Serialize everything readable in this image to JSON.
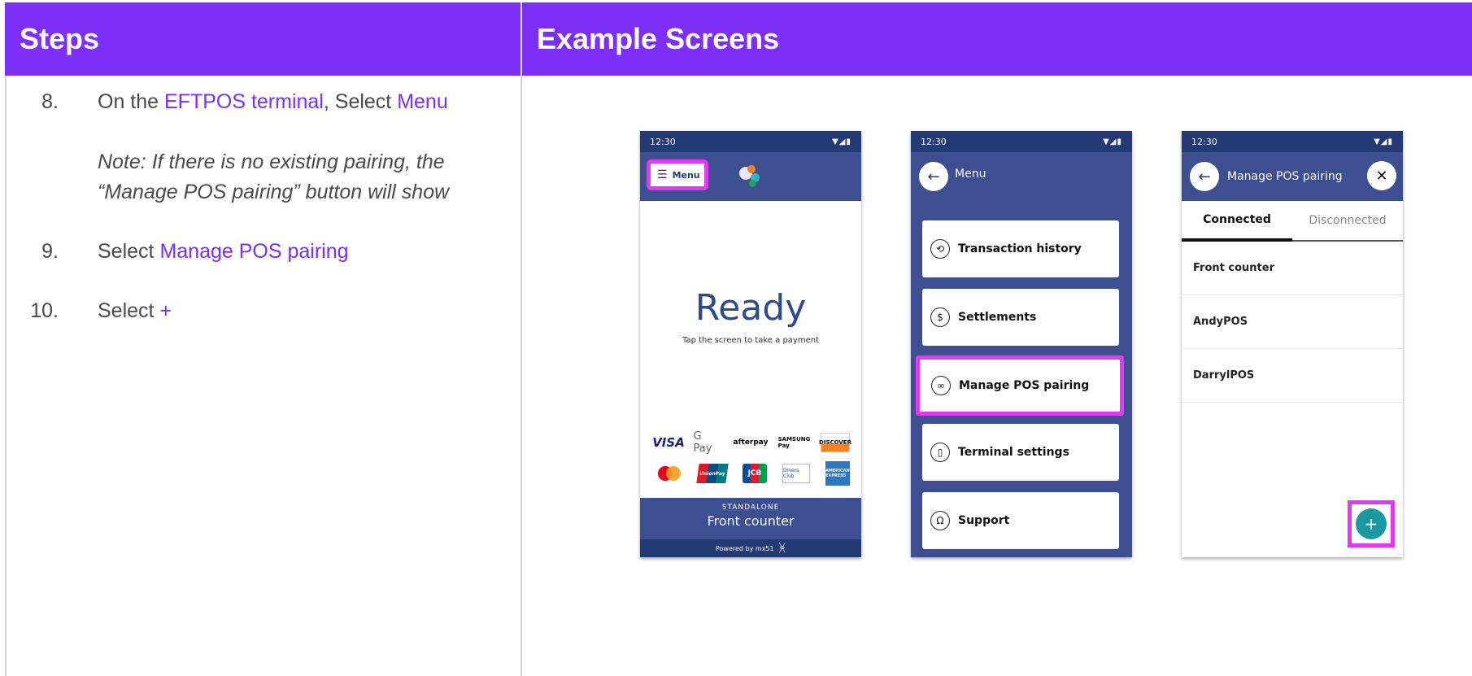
{
  "headers": {
    "steps": "Steps",
    "examples": "Example Screens"
  },
  "steps": [
    {
      "num": "8.",
      "prefix": "On the ",
      "link1": "EFTPOS terminal",
      "mid": ", Select ",
      "link2": "Menu"
    },
    {
      "num": "9.",
      "prefix": "Select ",
      "link1": "Manage POS pairing"
    },
    {
      "num": "10.",
      "prefix": "Select ",
      "link1": "+"
    }
  ],
  "note": {
    "line1": "Note: If there is no existing pairing, the",
    "line2": "“Manage POS pairing” button will show"
  },
  "phone1": {
    "time": "12:30",
    "menu_label": "Menu",
    "ready": "Ready",
    "tap": "Tap the screen to take a payment",
    "cards": {
      "visa": "VISA",
      "gpay": "G Pay",
      "afterpay": "afterpay",
      "samsung": "SAMSUNG Pay",
      "discover": "DISCOVER",
      "unionpay": "UnionPay",
      "jcb": "JCB",
      "diners": "Diners Club",
      "amex": "AMERICAN EXPRESS"
    },
    "standalone": "STANDALONE",
    "location": "Front counter",
    "powered": "Powered by mx51"
  },
  "phone2": {
    "time": "12:30",
    "title": "Menu",
    "items": [
      "Transaction history",
      "Settlements",
      "Manage POS pairing",
      "Terminal settings",
      "Support"
    ]
  },
  "phone3": {
    "time": "12:30",
    "title": "Manage POS pairing",
    "tabs": [
      "Connected",
      "Disconnected"
    ],
    "pairings": [
      "Front counter",
      "AndyPOS",
      "DarrylPOS"
    ],
    "fab": "+"
  },
  "colors": {
    "header": "#7b2ff7",
    "accent": "#7b2ff7",
    "highlight": "#e13bf2",
    "terminal_blue": "#3d4f90",
    "fab": "#1a9aa0"
  }
}
